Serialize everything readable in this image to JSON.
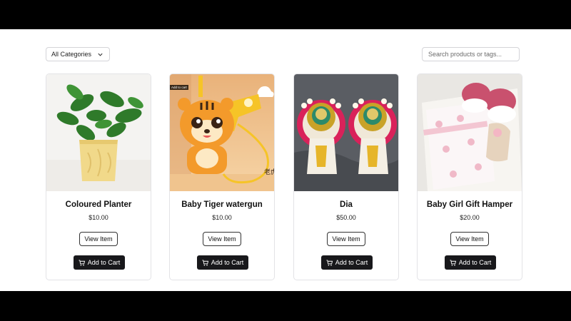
{
  "filter": {
    "selected": "All Categories",
    "icon": "chevron-down-icon"
  },
  "search": {
    "placeholder": "Search products or tags..."
  },
  "products": [
    {
      "name": "Coloured Planter",
      "price": "$10.00",
      "view_label": "View Item",
      "cart_label": "Add to Cart"
    },
    {
      "name": "Baby Tiger watergun",
      "price": "$10.00",
      "view_label": "View Item",
      "cart_label": "Add to Cart",
      "image_tag": "Add to cart"
    },
    {
      "name": "Dia",
      "price": "$50.00",
      "view_label": "View Item",
      "cart_label": "Add to Cart"
    },
    {
      "name": "Baby Girl Gift Hamper",
      "price": "$20.00",
      "view_label": "View Item",
      "cart_label": "Add to Cart"
    }
  ],
  "colors": {
    "button_dark": "#18181b",
    "border": "#e3e3e6"
  }
}
